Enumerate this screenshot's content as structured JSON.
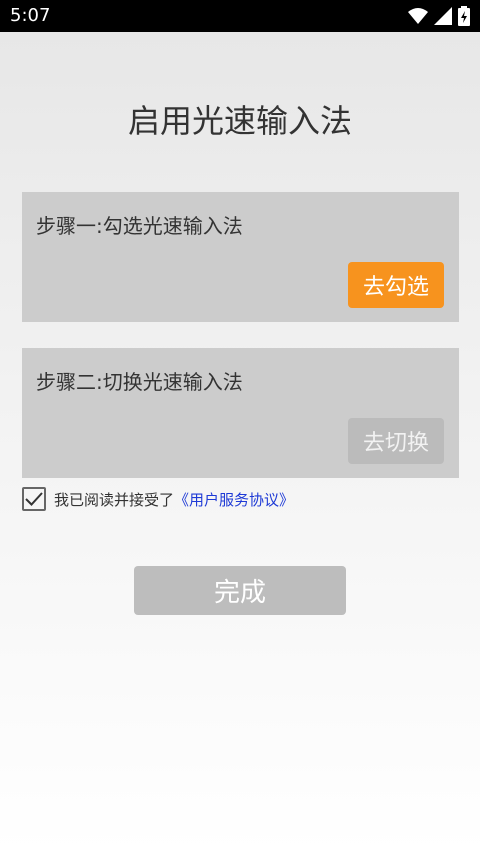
{
  "status_bar": {
    "time": "5:07",
    "icons": [
      "wifi-icon",
      "signal-icon",
      "battery-icon"
    ]
  },
  "title": "启用光速输入法",
  "steps": [
    {
      "label": "步骤一:勾选光速输入法",
      "button": "去勾选",
      "button_color": "#f7931e"
    },
    {
      "label": "步骤二:切换光速输入法",
      "button": "去切换",
      "button_color": "#bbbbbb"
    }
  ],
  "agreement": {
    "checked": true,
    "text": "我已阅读并接受了",
    "link": "《用户服务协议》"
  },
  "done_button": "完成",
  "colors": {
    "accent": "#f7931e",
    "link": "#1e3ad6",
    "card": "#cccccc",
    "disabled": "#bdbdbd"
  }
}
